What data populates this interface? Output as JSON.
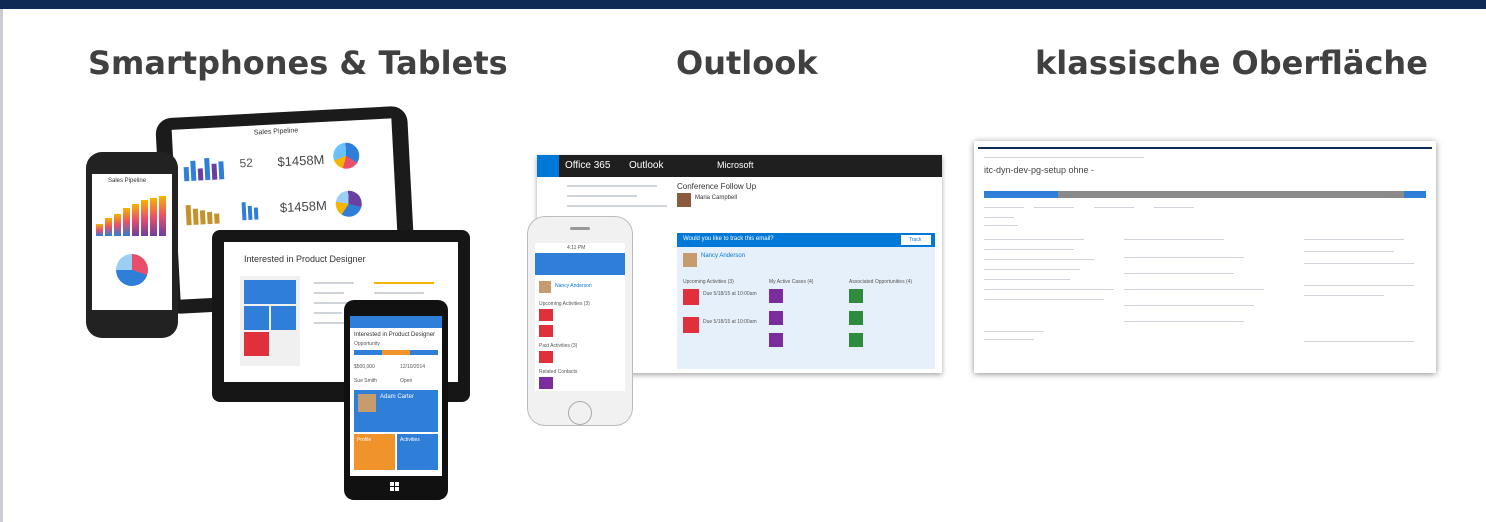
{
  "headings": {
    "mobile": "Smartphones & Tablets",
    "outlook": "Outlook",
    "classic": "klassische Oberfläche"
  },
  "ipad": {
    "title": "Sales Pipeline",
    "kpi1": "52",
    "kpi2": "$1458M",
    "kpi3": "$1458M"
  },
  "iphone1": {
    "title": "Sales Pipeline"
  },
  "surface": {
    "title": "Interested in Product Designer"
  },
  "winphone": {
    "title": "Interested in Product Designer",
    "subtitle": "Opportunity",
    "value1": "$500,000",
    "value2": "12/10/2014",
    "field1": "Sue Smith",
    "field2": "Open",
    "contact": "Adam Carter",
    "tile1": "Profile",
    "tile2": "Activities"
  },
  "outlook": {
    "app": "Office 365",
    "module": "Outlook",
    "brand": "Microsoft",
    "subject": "Conference Follow Up",
    "sender": "Maria Campbell",
    "panel_prompt": "Would you like to track this email?",
    "track_button": "Track",
    "contact": "Nancy Anderson",
    "col1": "Upcoming Activities (3)",
    "col2": "My Active Cases (4)",
    "col3": "Associated Opportunities (4)",
    "due1": "Due 5/18/15 at 10:00am",
    "due2": "Due 5/18/15 at 10:00am"
  },
  "iphone2": {
    "time": "4:11 PM",
    "contact": "Nancy Anderson",
    "section1": "Upcoming Activities (3)",
    "section2": "Past Activities (3)",
    "section3": "Related Contacts"
  },
  "classic": {
    "title": "itc-dyn-dev-pg-setup ohne -"
  },
  "colors": {
    "topbar": "#0f2a54",
    "heading": "#404040",
    "crm_blue": "#2f7ed8",
    "crm_red": "#e0303b",
    "crm_purple": "#7b2d9e",
    "crm_green": "#2e8b3e",
    "crm_orange": "#f0932b",
    "office_blue": "#0078d7"
  }
}
